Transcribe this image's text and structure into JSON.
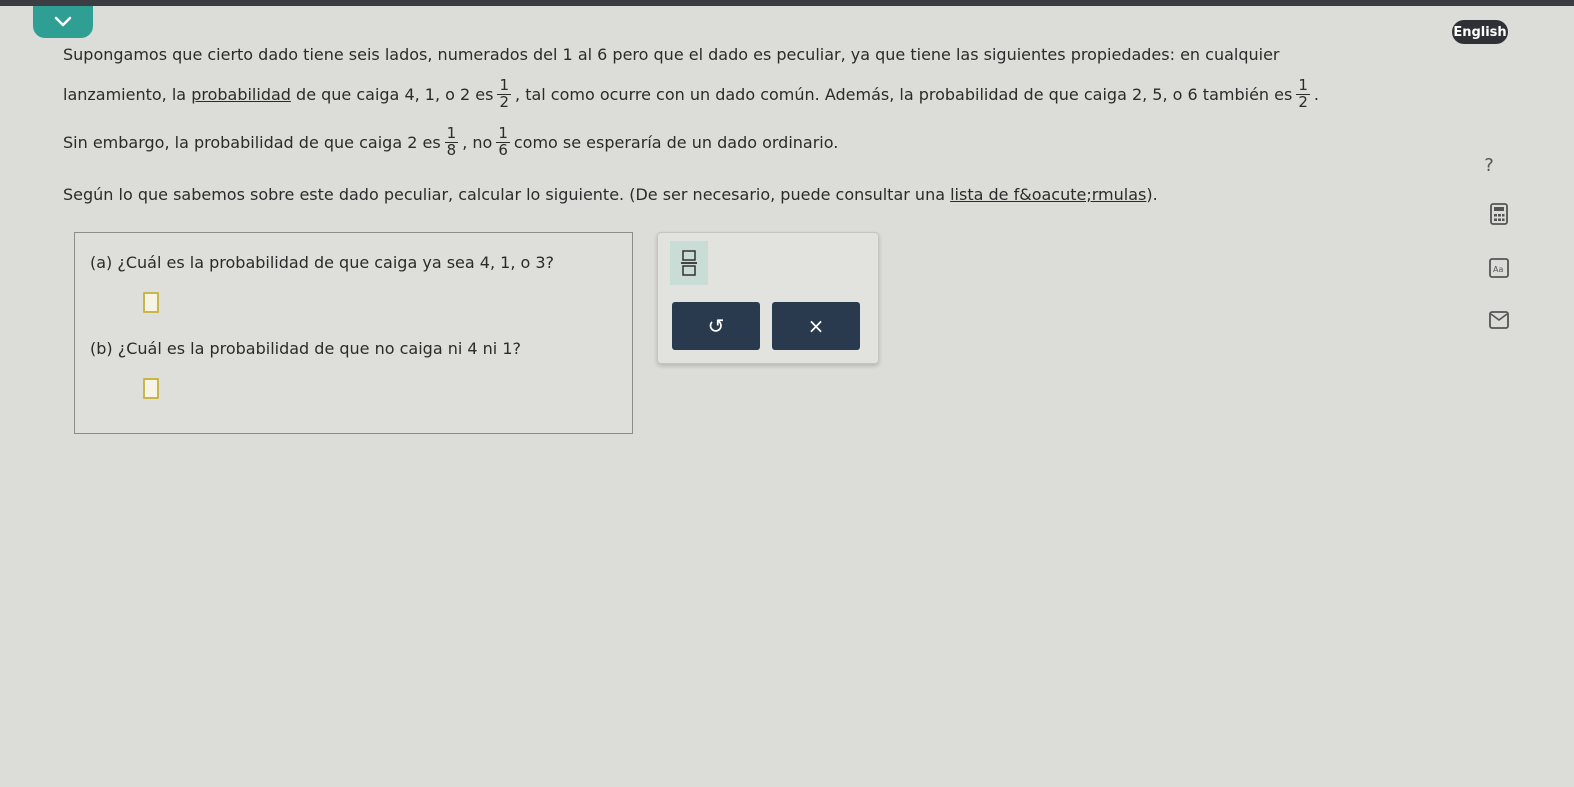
{
  "header": {
    "language_label": "English"
  },
  "problem": {
    "line1": "Supongamos que cierto dado tiene seis lados, numerados del 1 al 6 pero que el dado es peculiar, ya que tiene las siguientes propiedades: en cualquier",
    "line2_a": "lanzamiento, la",
    "line2_link": "probabilidad",
    "line2_b": "de que caiga 4, 1, o 2 es",
    "frac1_num": "1",
    "frac1_den": "2",
    "line2_c": ", tal como ocurre con un dado común. Además, la probabilidad de que caiga 2, 5, o 6 también es",
    "frac2_num": "1",
    "frac2_den": "2",
    "line2_end": ".",
    "line3_a": "Sin embargo, la probabilidad de que caiga 2 es",
    "frac3_num": "1",
    "frac3_den": "8",
    "line3_b": ", no",
    "frac4_num": "1",
    "frac4_den": "6",
    "line3_c": "como se esperaría de un dado ordinario.",
    "line4_a": "Según lo que sabemos sobre este dado peculiar, calcular lo siguiente. (De ser necesario, puede consultar una",
    "line4_link": "lista de f&oacute;rmulas",
    "line4_b": ")."
  },
  "questions": {
    "a_label": "(a) ¿Cuál es la probabilidad de que caiga ya sea 4, 1, o 3?",
    "a_value": "",
    "b_label": "(b) ¿Cuál es la probabilidad de que no caiga ni 4 ni 1?",
    "b_value": ""
  },
  "toolbar": {
    "undo_symbol": "↺",
    "clear_symbol": "×"
  },
  "side": {
    "help_symbol": "?"
  },
  "icons": [
    "chevron-down-icon",
    "fraction-icon",
    "undo-icon",
    "clear-icon",
    "help-icon",
    "calculator-icon",
    "textbook-icon",
    "message-icon"
  ],
  "colors": {
    "accent_teal": "#2f9f93",
    "answer_border": "#c9b64b",
    "tool_button": "#293a4f",
    "fraction_tool_bg": "#c9ddd6"
  }
}
